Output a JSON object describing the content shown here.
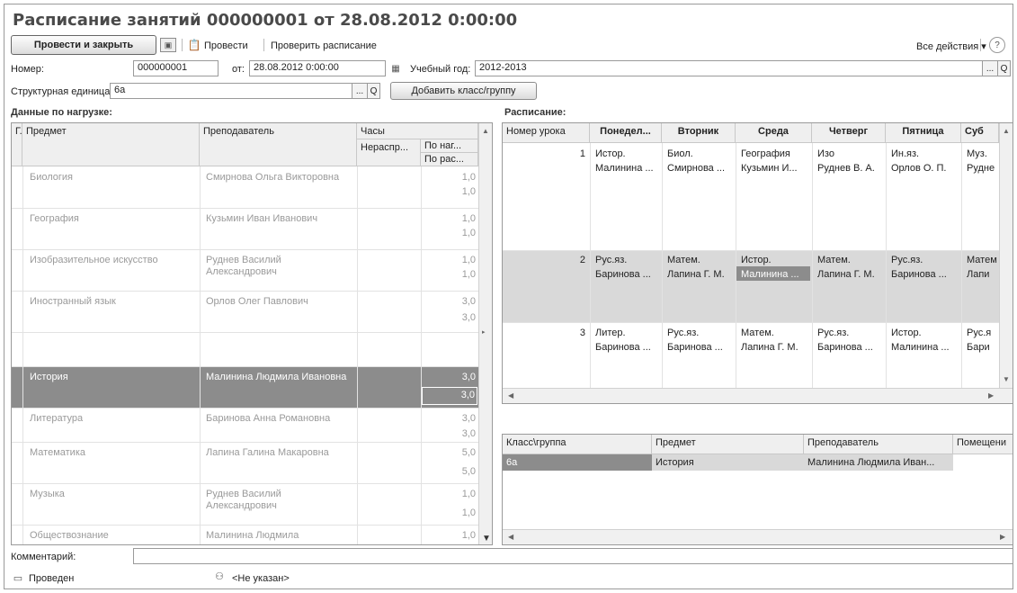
{
  "title": "Расписание занятий 000000001 от 28.08.2012 0:00:00",
  "toolbar": {
    "post_close": "Провести и закрыть",
    "post": "Провести",
    "check": "Проверить расписание",
    "all_actions": "Все действия ▾",
    "help": "?"
  },
  "form": {
    "number_label": "Номер:",
    "number_value": "000000001",
    "from_label": "от:",
    "from_value": "28.08.2012  0:00:00",
    "year_label": "Учебный год:",
    "year_value": "2012-2013",
    "unit_label": "Структурная единица:",
    "unit_value": "6а",
    "add_class": "Добавить класс/группу",
    "pick": "...",
    "search": "Q"
  },
  "load": {
    "section": "Данные по нагрузке:",
    "headers": {
      "g": "Г..",
      "subject": "Предмет",
      "teacher": "Преподаватель",
      "hours": "Часы",
      "unassigned": "Нераспр...",
      "by_load": "По наг...",
      "by_sched": "По рас..."
    },
    "rows": [
      {
        "subject": "Биология",
        "teacher": "Смирнова Ольга Викторовна",
        "load": "1,0",
        "sched": "1,0"
      },
      {
        "subject": "География",
        "teacher": "Кузьмин Иван Иванович",
        "load": "1,0",
        "sched": "1,0"
      },
      {
        "subject": "Изобразительное искусство",
        "teacher": "Руднев Василий Александрович",
        "load": "1,0",
        "sched": "1,0"
      },
      {
        "subject": "Иностранный язык",
        "teacher": "Орлов Олег Павлович",
        "load": "3,0",
        "sched": "3,0"
      },
      {
        "subject": "История",
        "teacher": "Малинина Людмила Ивановна",
        "load": "3,0",
        "sched": "3,0"
      },
      {
        "subject": "Литература",
        "teacher": "Баринова Анна Романовна",
        "load": "3,0",
        "sched": "3,0"
      },
      {
        "subject": "Математика",
        "teacher": "Лапина Галина Макаровна",
        "load": "5,0",
        "sched": "5,0"
      },
      {
        "subject": "Музыка",
        "teacher": "Руднев Василий Александрович",
        "load": "1,0",
        "sched": "1,0"
      },
      {
        "subject": "Обществознание",
        "teacher": "Малинина Людмила",
        "load": "1,0",
        "sched": ""
      }
    ]
  },
  "schedule": {
    "section": "Расписание:",
    "headers": [
      "Номер урока",
      "Понедел...",
      "Вторник",
      "Среда",
      "Четверг",
      "Пятница",
      "Суб"
    ],
    "lessons": [
      {
        "num": "1",
        "subj": [
          "Истор.",
          "Биол.",
          "География",
          "Изо",
          "Ин.яз.",
          "Муз."
        ],
        "teach": [
          "Малинина ...",
          "Смирнова ...",
          "Кузьмин И...",
          "Руднев В. А.",
          "Орлов О. П.",
          "Рудне"
        ]
      },
      {
        "num": "2",
        "subj": [
          "Рус.яз.",
          "Матем.",
          "Истор.",
          "Матем.",
          "Рус.яз.",
          "Матем"
        ],
        "teach": [
          "Баринова ...",
          "Лапина Г. М.",
          "Малинина ...",
          "Лапина Г. М.",
          "Баринова ...",
          "Лапи"
        ]
      },
      {
        "num": "3",
        "subj": [
          "Литер.",
          "Рус.яз.",
          "Матем.",
          "Рус.яз.",
          "Истор.",
          "Рус.я"
        ],
        "teach": [
          "Баринова ...",
          "Баринова ...",
          "Лапина Г. М.",
          "Баринова ...",
          "Малинина ...",
          "Бари"
        ]
      }
    ]
  },
  "detail": {
    "headers": [
      "Класс\\группа",
      "Предмет",
      "Преподаватель",
      "Помещени"
    ],
    "row": [
      "6а",
      "История",
      "Малинина Людмила Иван...",
      ""
    ]
  },
  "footer": {
    "comment_label": "Комментарий:",
    "comment_value": "",
    "status": "Проведен",
    "author": "<Не указан>"
  }
}
